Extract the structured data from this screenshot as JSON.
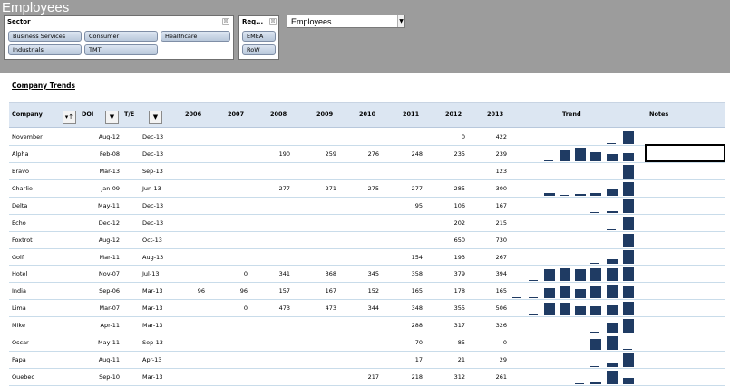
{
  "app": {
    "title": "Employees"
  },
  "slicers": {
    "sector": {
      "header": "Sector",
      "items": [
        "Business Services",
        "Consumer",
        "Healthcare",
        "Industrials",
        "TMT"
      ]
    },
    "region": {
      "header": "Req...",
      "items": [
        "EMEA",
        "RoW"
      ]
    }
  },
  "dropdown": {
    "value": "Employees"
  },
  "section": {
    "title": "Company Trends"
  },
  "table": {
    "headers": {
      "company": "Company",
      "doi": "DOI",
      "te": "T/E",
      "years": [
        "2006",
        "2007",
        "2008",
        "2009",
        "2010",
        "2011",
        "2012",
        "2013"
      ],
      "trend": "Trend",
      "notes": "Notes"
    },
    "filter_icon": "filter-sort-icon",
    "dropdown_icon": "chevron-down-icon",
    "rows": [
      {
        "company": "November",
        "doi": "Aug-12",
        "te": "Dec-13",
        "values": [
          "",
          "",
          "",
          "",
          "",
          "",
          "0",
          "422"
        ]
      },
      {
        "company": "Alpha",
        "doi": "Feb-08",
        "te": "Dec-13",
        "values": [
          "",
          "",
          "190",
          "259",
          "276",
          "248",
          "235",
          "239"
        ]
      },
      {
        "company": "Bravo",
        "doi": "Mar-13",
        "te": "Sep-13",
        "values": [
          "",
          "",
          "",
          "",
          "",
          "",
          "",
          "123"
        ]
      },
      {
        "company": "Charlie",
        "doi": "Jan-09",
        "te": "Jun-13",
        "values": [
          "",
          "",
          "277",
          "271",
          "275",
          "277",
          "285",
          "300"
        ]
      },
      {
        "company": "Delta",
        "doi": "May-11",
        "te": "Dec-13",
        "values": [
          "",
          "",
          "",
          "",
          "",
          "95",
          "106",
          "167"
        ]
      },
      {
        "company": "Echo",
        "doi": "Dec-12",
        "te": "Dec-13",
        "values": [
          "",
          "",
          "",
          "",
          "",
          "",
          "202",
          "215"
        ]
      },
      {
        "company": "Foxtrot",
        "doi": "Aug-12",
        "te": "Oct-13",
        "values": [
          "",
          "",
          "",
          "",
          "",
          "",
          "650",
          "730"
        ]
      },
      {
        "company": "Golf",
        "doi": "Mar-11",
        "te": "Aug-13",
        "values": [
          "",
          "",
          "",
          "",
          "",
          "154",
          "193",
          "267"
        ]
      },
      {
        "company": "Hotel",
        "doi": "Nov-07",
        "te": "Jul-13",
        "values": [
          "",
          "0",
          "341",
          "368",
          "345",
          "358",
          "379",
          "394"
        ]
      },
      {
        "company": "India",
        "doi": "Sep-06",
        "te": "Mar-13",
        "values": [
          "96",
          "96",
          "157",
          "167",
          "152",
          "165",
          "178",
          "165"
        ]
      },
      {
        "company": "Lima",
        "doi": "Mar-07",
        "te": "Mar-13",
        "values": [
          "",
          "0",
          "473",
          "473",
          "344",
          "348",
          "355",
          "506"
        ]
      },
      {
        "company": "Mike",
        "doi": "Apr-11",
        "te": "Mar-13",
        "values": [
          "",
          "",
          "",
          "",
          "",
          "288",
          "317",
          "326"
        ]
      },
      {
        "company": "Oscar",
        "doi": "May-11",
        "te": "Sep-13",
        "values": [
          "",
          "",
          "",
          "",
          "",
          "70",
          "85",
          "0"
        ]
      },
      {
        "company": "Papa",
        "doi": "Aug-11",
        "te": "Apr-13",
        "values": [
          "",
          "",
          "",
          "",
          "",
          "17",
          "21",
          "29"
        ]
      },
      {
        "company": "Quebec",
        "doi": "Sep-10",
        "te": "Mar-13",
        "values": [
          "",
          "",
          "",
          "",
          "217",
          "218",
          "312",
          "261"
        ]
      }
    ]
  },
  "colors": {
    "bar": "#1f3b63",
    "header_fill": "#dce6f2",
    "top_band": "#9c9c9c"
  }
}
